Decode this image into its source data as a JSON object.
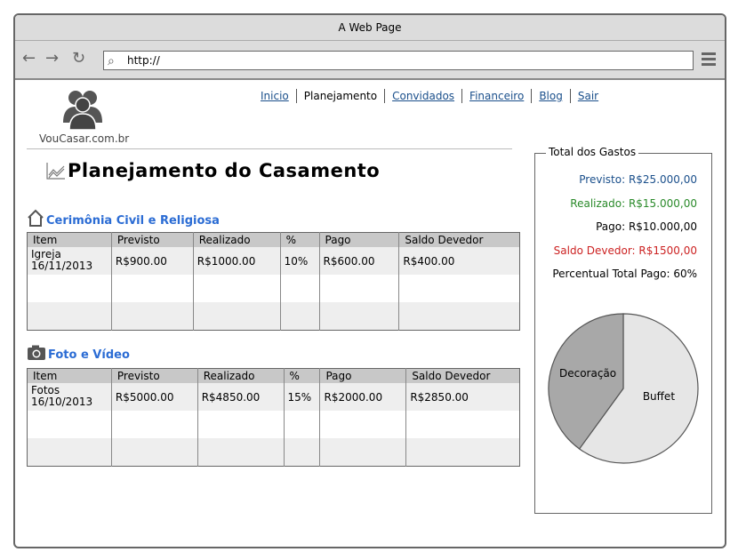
{
  "window": {
    "title": "A Web Page"
  },
  "browser": {
    "url": "http://"
  },
  "logo": {
    "text": "VouCasar.com.br"
  },
  "nav": {
    "items": [
      {
        "label": "Inicio",
        "active": false
      },
      {
        "label": "Planejamento",
        "active": true
      },
      {
        "label": "Convidados",
        "active": false
      },
      {
        "label": "Financeiro",
        "active": false
      },
      {
        "label": "Blog",
        "active": false
      },
      {
        "label": "Sair",
        "active": false
      }
    ]
  },
  "page": {
    "title": "Planejamento do Casamento"
  },
  "sections": [
    {
      "title": "Cerimônia Civil e Religiosa",
      "icon": "home-icon",
      "columns": [
        "Item",
        "Previsto",
        "Realizado",
        "%",
        "Pago",
        "Saldo Devedor"
      ],
      "rows": [
        {
          "item_line1": "Igreja",
          "item_line2": "16/11/2013",
          "previsto": "R$900.00",
          "realizado": "R$1000.00",
          "pct": "10%",
          "pago": "R$600.00",
          "saldo": "R$400.00"
        }
      ]
    },
    {
      "title": "Foto e Vídeo",
      "icon": "camera-icon",
      "columns": [
        "Item",
        "Previsto",
        "Realizado",
        "%",
        "Pago",
        "Saldo Devedor"
      ],
      "rows": [
        {
          "item_line1": "Fotos",
          "item_line2": "16/10/2013",
          "previsto": "R$5000.00",
          "realizado": "R$4850.00",
          "pct": "15%",
          "pago": "R$2000.00",
          "saldo": "R$2850.00"
        }
      ]
    }
  ],
  "summary": {
    "legend": "Total dos Gastos",
    "previsto": "Previsto: R$25.000,00",
    "realizado": "Realizado: R$15.000,00",
    "pago": "Pago: R$10.000,00",
    "saldo": "Saldo Devedor: R$1500,00",
    "percentual": "Percentual Total Pago: 60%",
    "colors": {
      "previsto": "#1a4f8b",
      "realizado": "#2a8a2a",
      "pago": "#000000",
      "saldo": "#cc2222",
      "percentual": "#000000"
    }
  },
  "chart_data": {
    "type": "pie",
    "slices": [
      {
        "label": "Buffet",
        "value": 60,
        "color": "#e6e6e6"
      },
      {
        "label": "Decoração",
        "value": 40,
        "color": "#a8a8a8"
      }
    ]
  }
}
